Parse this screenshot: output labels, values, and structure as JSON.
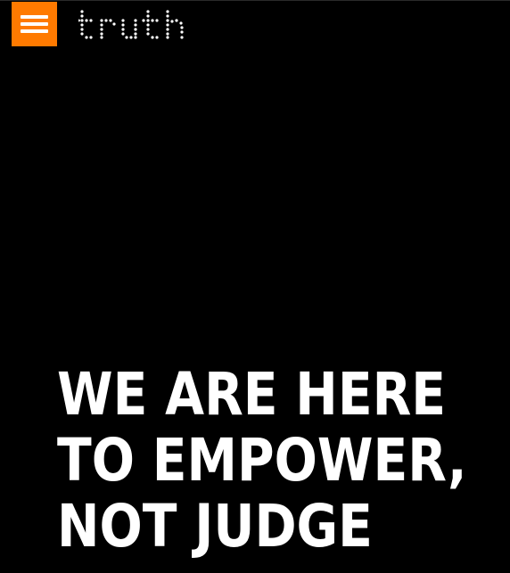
{
  "header": {
    "menu_icon": "hamburger-icon",
    "menu_color": "#ff7a00",
    "logo_text": "truth"
  },
  "hero": {
    "headline_lines": [
      "WE ARE HERE",
      "TO EMPOWER,",
      "NOT JUDGE"
    ]
  }
}
